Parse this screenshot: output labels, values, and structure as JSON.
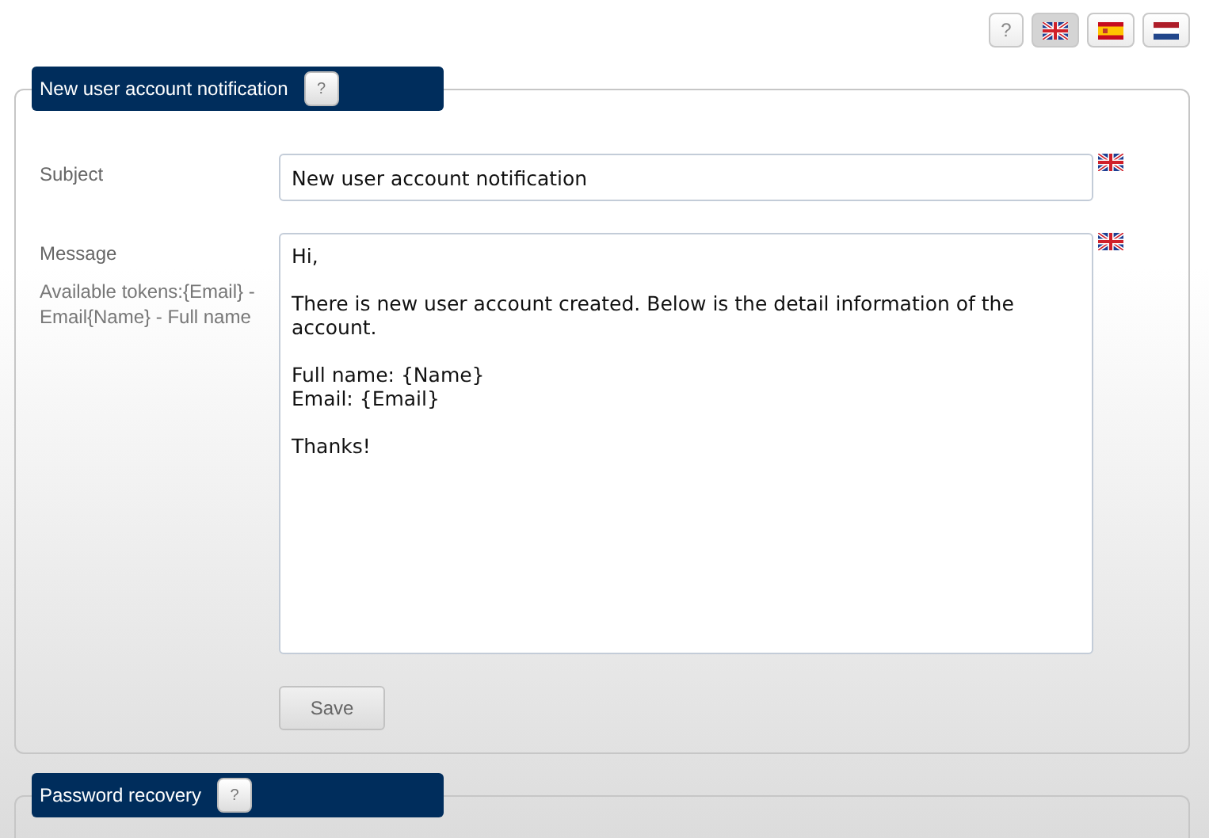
{
  "toolbar": {
    "help": "?",
    "languages": [
      {
        "kind": "uk",
        "selected": true
      },
      {
        "kind": "es",
        "selected": false
      },
      {
        "kind": "nl",
        "selected": false
      }
    ]
  },
  "sections": [
    {
      "title": "New user account notification",
      "help": "?",
      "fields": [
        {
          "kind": "input",
          "label": "Subject",
          "value": "New user account notification",
          "flag": {
            "kind": "uk"
          }
        },
        {
          "kind": "textarea",
          "label": "Message",
          "hint": "Available tokens:{Email} - Email{Name} - Full name",
          "value": "Hi,\n\nThere is new user account created. Below is the detail information of the account.\n\nFull name: {Name}\nEmail: {Email}\n\nThanks!",
          "flag": {
            "kind": "uk"
          }
        }
      ],
      "save": "Save"
    },
    {
      "title": "Password recovery",
      "help": "?"
    }
  ]
}
